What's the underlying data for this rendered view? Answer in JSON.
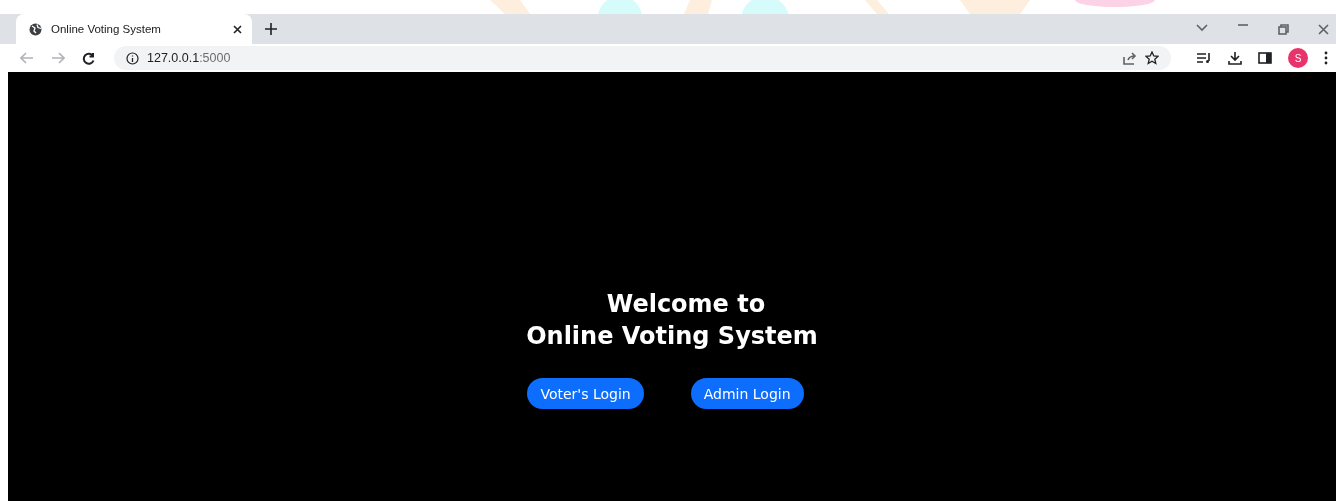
{
  "browser": {
    "tabs": [
      {
        "title": "Online Voting System",
        "selected": true
      }
    ],
    "address": {
      "host": "127.0.0.1",
      "port": ":5000"
    },
    "profile_initial": "S"
  },
  "page": {
    "heading_lines": [
      "Welcome to",
      "Online Voting System"
    ],
    "buttons": [
      {
        "label": "Voter's Login"
      },
      {
        "label": "Admin Login"
      }
    ]
  }
}
